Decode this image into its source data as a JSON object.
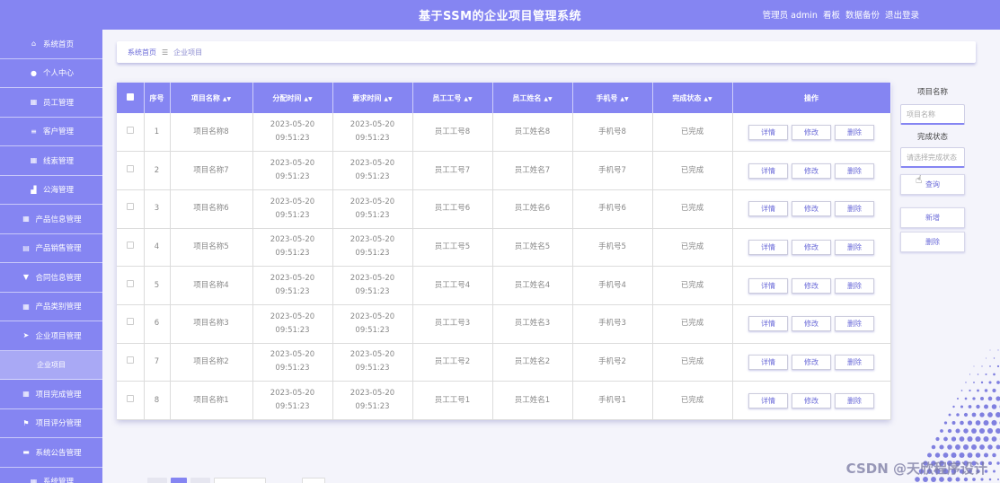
{
  "header": {
    "title": "基于SSM的企业项目管理系统",
    "role_user": "管理员 admin",
    "board": "看板",
    "backup": "数据备份",
    "logout": "退出登录"
  },
  "sidebar": {
    "items": [
      {
        "label": "系统首页",
        "icon": "home-icon"
      },
      {
        "label": "个人中心",
        "icon": "user-icon"
      },
      {
        "label": "员工管理",
        "icon": "grid-icon"
      },
      {
        "label": "客户管理",
        "icon": "list-icon"
      },
      {
        "label": "线索管理",
        "icon": "grid-icon"
      },
      {
        "label": "公海管理",
        "icon": "thumb-icon"
      },
      {
        "label": "产品信息管理",
        "icon": "grid-icon"
      },
      {
        "label": "产品销售管理",
        "icon": "clipboard-icon"
      },
      {
        "label": "合同信息管理",
        "icon": "pin-icon"
      },
      {
        "label": "产品类别管理",
        "icon": "grid-icon"
      },
      {
        "label": "企业项目管理",
        "icon": "plane-icon"
      },
      {
        "label": "企业项目",
        "icon": "",
        "sub": true
      },
      {
        "label": "项目完成管理",
        "icon": "grid-icon"
      },
      {
        "label": "项目评分管理",
        "icon": "flag-icon"
      },
      {
        "label": "系统公告管理",
        "icon": "briefcase-icon"
      },
      {
        "label": "系统管理",
        "icon": "grid-icon"
      }
    ]
  },
  "breadcrumb": {
    "home": "系统首页",
    "separator": "☰",
    "current": "企业项目"
  },
  "table": {
    "headers": [
      "序号",
      "项目名称",
      "分配时间",
      "要求时间",
      "员工工号",
      "员工姓名",
      "手机号",
      "完成状态",
      "操作"
    ],
    "rows": [
      {
        "idx": "1",
        "name": "项目名称8",
        "assign": "2023-05-20 09:51:23",
        "require": "2023-05-20 09:51:23",
        "empno": "员工工号8",
        "empname": "员工姓名8",
        "phone": "手机号8",
        "status": "已完成"
      },
      {
        "idx": "2",
        "name": "项目名称7",
        "assign": "2023-05-20 09:51:23",
        "require": "2023-05-20 09:51:23",
        "empno": "员工工号7",
        "empname": "员工姓名7",
        "phone": "手机号7",
        "status": "已完成"
      },
      {
        "idx": "3",
        "name": "项目名称6",
        "assign": "2023-05-20 09:51:23",
        "require": "2023-05-20 09:51:23",
        "empno": "员工工号6",
        "empname": "员工姓名6",
        "phone": "手机号6",
        "status": "已完成"
      },
      {
        "idx": "4",
        "name": "项目名称5",
        "assign": "2023-05-20 09:51:23",
        "require": "2023-05-20 09:51:23",
        "empno": "员工工号5",
        "empname": "员工姓名5",
        "phone": "手机号5",
        "status": "已完成"
      },
      {
        "idx": "5",
        "name": "项目名称4",
        "assign": "2023-05-20 09:51:23",
        "require": "2023-05-20 09:51:23",
        "empno": "员工工号4",
        "empname": "员工姓名4",
        "phone": "手机号4",
        "status": "已完成"
      },
      {
        "idx": "6",
        "name": "项目名称3",
        "assign": "2023-05-20 09:51:23",
        "require": "2023-05-20 09:51:23",
        "empno": "员工工号3",
        "empname": "员工姓名3",
        "phone": "手机号3",
        "status": "已完成"
      },
      {
        "idx": "7",
        "name": "项目名称2",
        "assign": "2023-05-20 09:51:23",
        "require": "2023-05-20 09:51:23",
        "empno": "员工工号2",
        "empname": "员工姓名2",
        "phone": "手机号2",
        "status": "已完成"
      },
      {
        "idx": "8",
        "name": "项目名称1",
        "assign": "2023-05-20 09:51:23",
        "require": "2023-05-20 09:51:23",
        "empno": "员工工号1",
        "empname": "员工姓名1",
        "phone": "手机号1",
        "status": "已完成"
      }
    ],
    "actions": {
      "detail": "详情",
      "edit": "修改",
      "delete": "删除"
    }
  },
  "search": {
    "name_label": "项目名称",
    "name_placeholder": "项目名称",
    "status_label": "完成状态",
    "status_placeholder": "请选择完成状态",
    "query": "查询",
    "add": "新增",
    "delete": "删除"
  },
  "watermark": "CSDN @天欣程序设计",
  "colors": {
    "accent": "#8585f2"
  }
}
